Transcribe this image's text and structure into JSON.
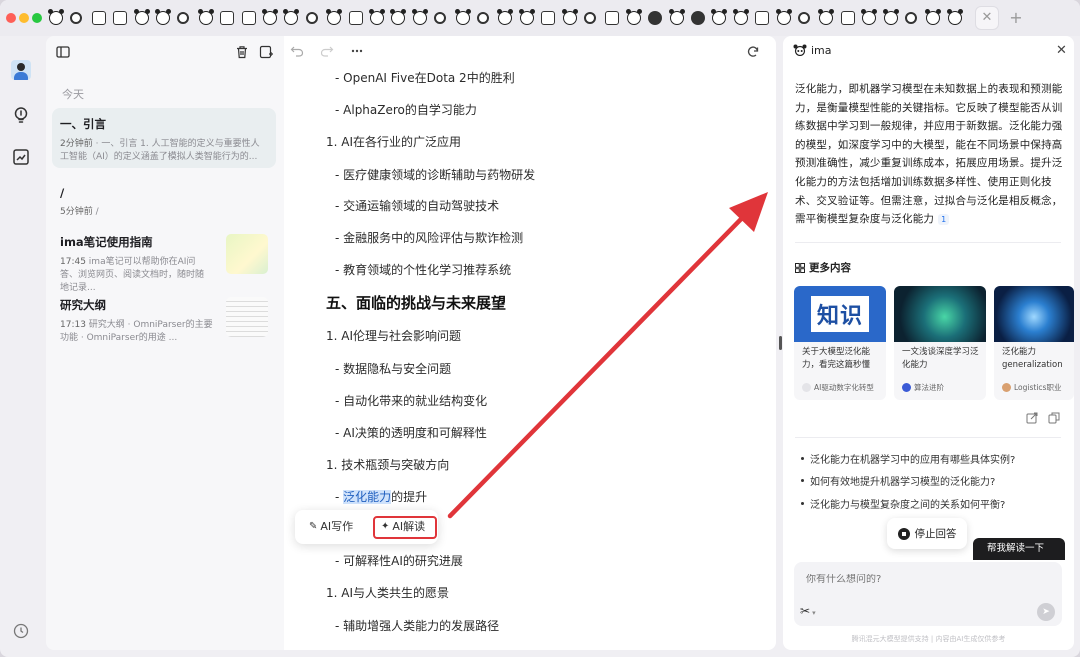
{
  "app": {
    "name": "ima"
  },
  "tabbar": {
    "tab_icons": [
      "panda",
      "bulb",
      "chart",
      "chart",
      "panda",
      "panda",
      "bulb",
      "panda",
      "chart",
      "chart",
      "panda",
      "panda",
      "bulb",
      "panda",
      "chart",
      "panda",
      "panda",
      "panda",
      "bulb",
      "panda",
      "bulb",
      "panda",
      "panda",
      "chart",
      "panda",
      "bulb",
      "chart",
      "panda",
      "dot",
      "panda",
      "dot",
      "panda",
      "panda",
      "chart",
      "panda",
      "bulb",
      "panda",
      "chart",
      "panda",
      "panda",
      "bulb",
      "panda",
      "panda"
    ],
    "active_tab_close": "✕",
    "new_tab": "+"
  },
  "notes": {
    "section": "今天",
    "items": [
      {
        "title": "一、引言",
        "meta_time": "2分钟前",
        "meta_text": " · 一、引言   1. 人工智能的定义与重要性人工智能（AI）的定义涵盖了模拟人类智能行为的..."
      },
      {
        "title": "/",
        "meta_time": "5分钟前",
        "meta_text": " /"
      },
      {
        "title": "ima笔记使用指南",
        "meta_time": "17:45",
        "meta_text": " ima笔记可以帮助你在AI问答、浏览网页、阅读文档时，随时随地记录..."
      },
      {
        "title": "研究大纲",
        "meta_time": "17:13",
        "meta_text": " 研究大纲   · OmniParser的主要功能   · OmniParser的用途     ..."
      }
    ]
  },
  "editor": {
    "lines": [
      {
        "text": "- OpenAI Five在Dota 2中的胜利"
      },
      {
        "text": "- AlphaZero的自学习能力"
      },
      {
        "text": "1.    AI在各行业的广泛应用"
      },
      {
        "text": "- 医疗健康领域的诊断辅助与药物研发"
      },
      {
        "text": "- 交通运输领域的自动驾驶技术"
      },
      {
        "text": "- 金融服务中的风险评估与欺诈检测"
      },
      {
        "text": "- 教育领域的个性化学习推荐系统"
      },
      {
        "text": "五、面临的挑战与未来展望"
      },
      {
        "text": "1.    AI伦理与社会影响问题"
      },
      {
        "text": "- 数据隐私与安全问题"
      },
      {
        "text": "- 自动化带来的就业结构变化"
      },
      {
        "text": "- AI决策的透明度和可解释性"
      },
      {
        "text": "1.    技术瓶颈与突破方向"
      },
      {
        "text": "- 可解释性AI的研究进展"
      },
      {
        "text": "1.    AI与人类共生的愿景"
      },
      {
        "text": "- 辅助增强人类能力的发展路径"
      }
    ],
    "selected_line": {
      "prefix": "- ",
      "highlight": "泛化能力",
      "suffix": "的提升"
    },
    "popup": {
      "write": "AI写作",
      "explain": "AI解读"
    }
  },
  "assistant": {
    "title": "ima",
    "answer": "泛化能力，即机器学习模型在未知数据上的表现和预测能力，是衡量模型性能的关键指标。它反映了模型能否从训练数据中学习到一般规律，并应用于新数据。泛化能力强的模型，如深度学习中的大模型，能在不同场景中保持高预测准确性，减少重复训练成本，拓展应用场景。提升泛化能力的方法包括增加训练数据多样性、使用正则化技术、交叉验证等。但需注意，过拟合与泛化是相反概念，需平衡模型复杂度与泛化能力",
    "citation": "1",
    "more_title": "更多内容",
    "cards": [
      {
        "title": "关于大模型泛化能力，看完这篇秒懂",
        "source": "AI驱动数字化转型",
        "img_text": "知识"
      },
      {
        "title": "一文浅谈深度学习泛化能力",
        "source": "算法进阶",
        "img_text": ""
      },
      {
        "title": "泛化能力 generalization ability",
        "source": "Logistics职业",
        "img_text": ""
      }
    ],
    "suggestions": [
      "泛化能力在机器学习中的应用有哪些具体实例?",
      "如何有效地提升机器学习模型的泛化能力?",
      "泛化能力与模型复杂度之间的关系如何平衡?"
    ],
    "stop_label": "停止回答",
    "partial_button": "帮我解读一下",
    "input_placeholder": "你有什么想问的?",
    "footer": "腾讯混元大模型提供支持 | 内容由AI生成仅供参考"
  },
  "colors": {
    "accent_red": "#e0353a",
    "highlight": "#cfe2fb",
    "link_blue": "#1f6feb"
  }
}
